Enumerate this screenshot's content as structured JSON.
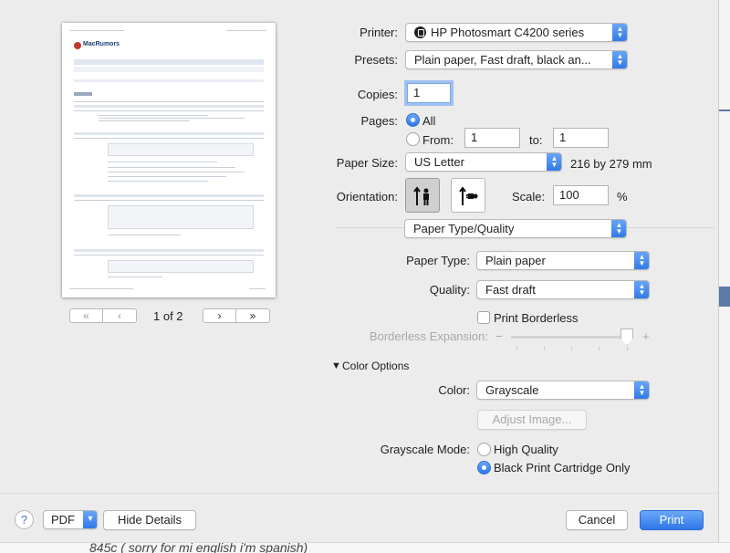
{
  "preview": {
    "page_label": "1 of 2",
    "first_label": "«",
    "prev_label": "‹",
    "next_label": "›",
    "last_label": "»",
    "site_logo": "MacRumors"
  },
  "printer": {
    "label": "Printer:",
    "value": "HP Photosmart C4200 series"
  },
  "presets": {
    "label": "Presets:",
    "value": "Plain paper, Fast draft, black an..."
  },
  "copies": {
    "label": "Copies:",
    "value": "1"
  },
  "pages": {
    "label": "Pages:",
    "all_label": "All",
    "from_label": "From:",
    "from_value": "1",
    "to_label": "to:",
    "to_value": "1",
    "selected": "all"
  },
  "paper_size": {
    "label": "Paper Size:",
    "value": "US Letter",
    "dims": "216 by 279 mm"
  },
  "orientation": {
    "label": "Orientation:",
    "selected": "portrait"
  },
  "scale": {
    "label": "Scale:",
    "value": "100",
    "unit": "%"
  },
  "section_popup": {
    "value": "Paper Type/Quality"
  },
  "paper_type": {
    "label": "Paper Type:",
    "value": "Plain paper"
  },
  "quality": {
    "label": "Quality:",
    "value": "Fast draft"
  },
  "borderless": {
    "label": "Print Borderless",
    "checked": false
  },
  "borderless_expansion": {
    "label": "Borderless Expansion:",
    "minus": "−",
    "plus": "+",
    "level": 1.0
  },
  "color_options": {
    "label": "Color Options",
    "expanded": true
  },
  "color": {
    "label": "Color:",
    "value": "Grayscale"
  },
  "adjust_image": {
    "label": "Adjust Image..."
  },
  "grayscale_mode": {
    "label": "Grayscale Mode:",
    "options": [
      "High Quality",
      "Black Print Cartridge Only"
    ],
    "selected": "Black Print Cartridge Only"
  },
  "footer": {
    "help": "?",
    "pdf": "PDF",
    "hide_details": "Hide Details",
    "cancel": "Cancel",
    "print": "Print"
  },
  "background": {
    "bottom_text": "845c ( sorry for mi english i'm spanish)"
  },
  "colors": {
    "accent": "#2f77e8",
    "focus_ring": "#9ec1f1"
  }
}
